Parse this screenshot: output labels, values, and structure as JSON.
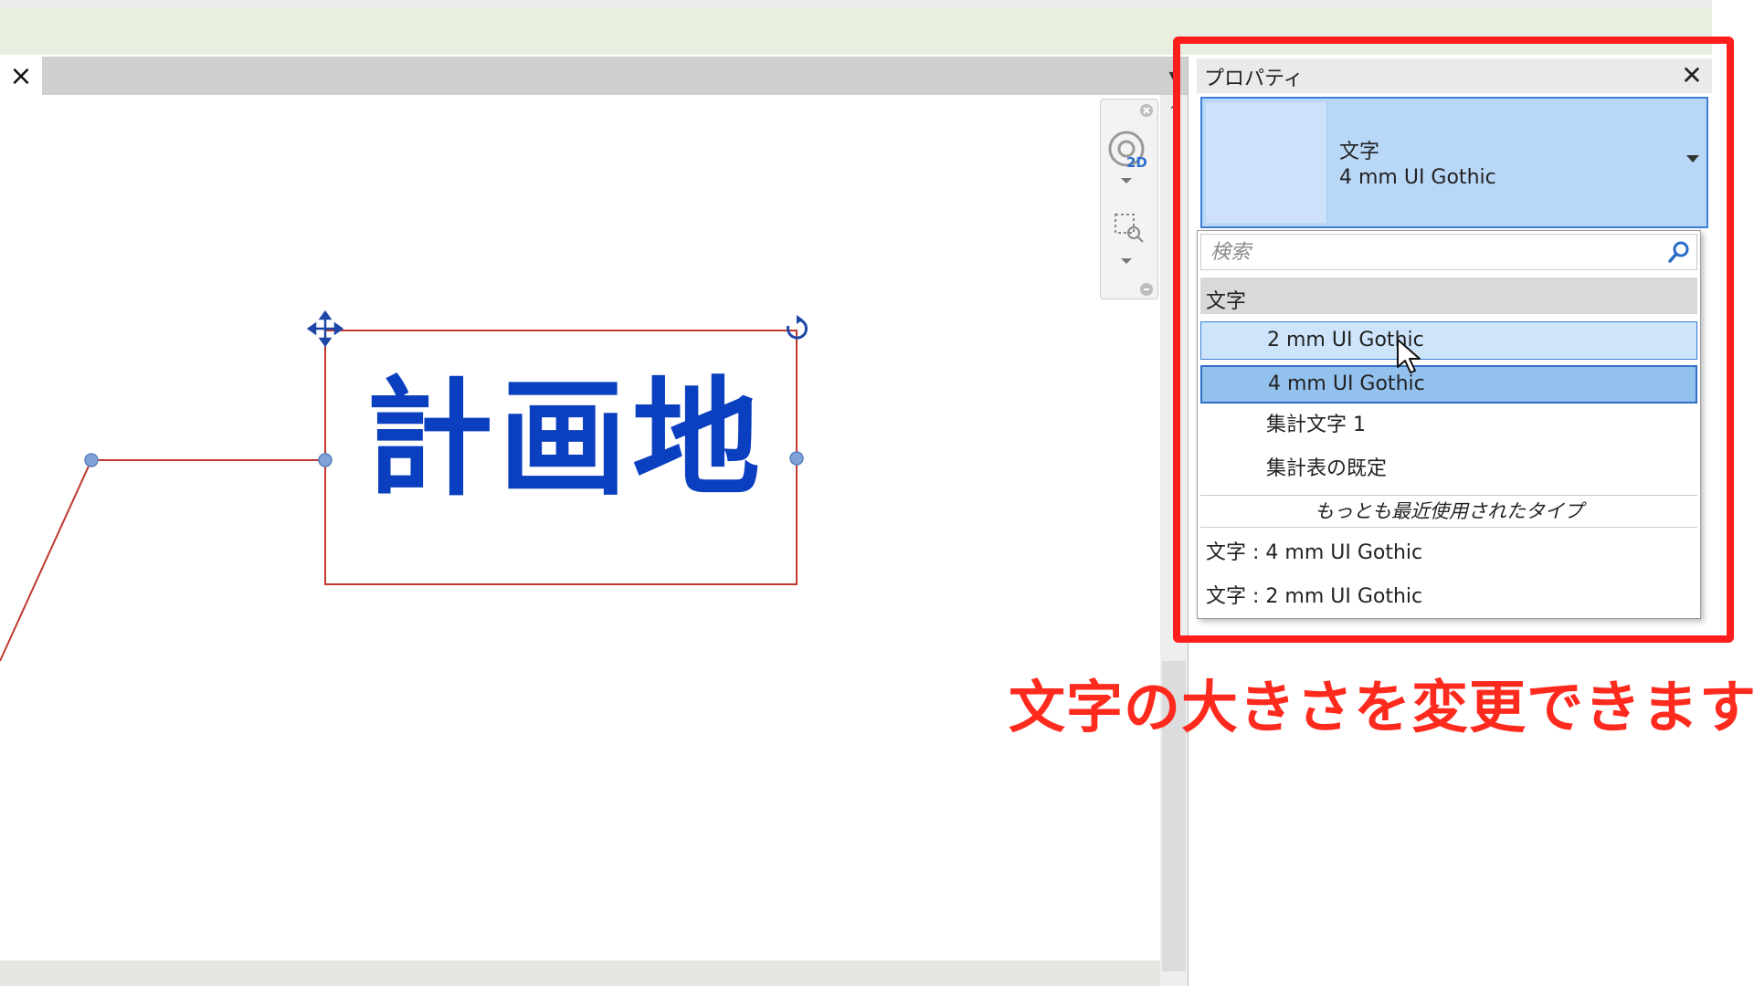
{
  "view": {
    "close_icon": "×",
    "tab_menu_icon": "▾"
  },
  "canvas": {
    "text_element": "計画地",
    "accent_color": "#0a3fbf",
    "selection_color": "#c0382e",
    "grip_color": "#7fa3d9"
  },
  "nav_bar": {
    "wheel_badge": "2D"
  },
  "properties": {
    "title": "プロパティ",
    "close_icon": "✕",
    "type_selector": {
      "family": "文字",
      "type_name": "4 mm UI Gothic"
    },
    "dropdown": {
      "search_placeholder": "検索",
      "group_label": "文字",
      "items": [
        {
          "label": "2 mm UI Gothic",
          "state": "hover"
        },
        {
          "label": "4 mm UI Gothic",
          "state": "selected"
        },
        {
          "label": "集計文字 1",
          "state": "normal"
        },
        {
          "label": "集計表の既定",
          "state": "normal"
        }
      ],
      "recent_header": "もっとも最近使用されたタイプ",
      "recent_items": [
        "文字 : 4 mm UI Gothic",
        "文字 : 2 mm UI Gothic"
      ]
    }
  },
  "annotation": {
    "text": "文字の大きさを変更できます",
    "color": "#ff2a1e"
  }
}
